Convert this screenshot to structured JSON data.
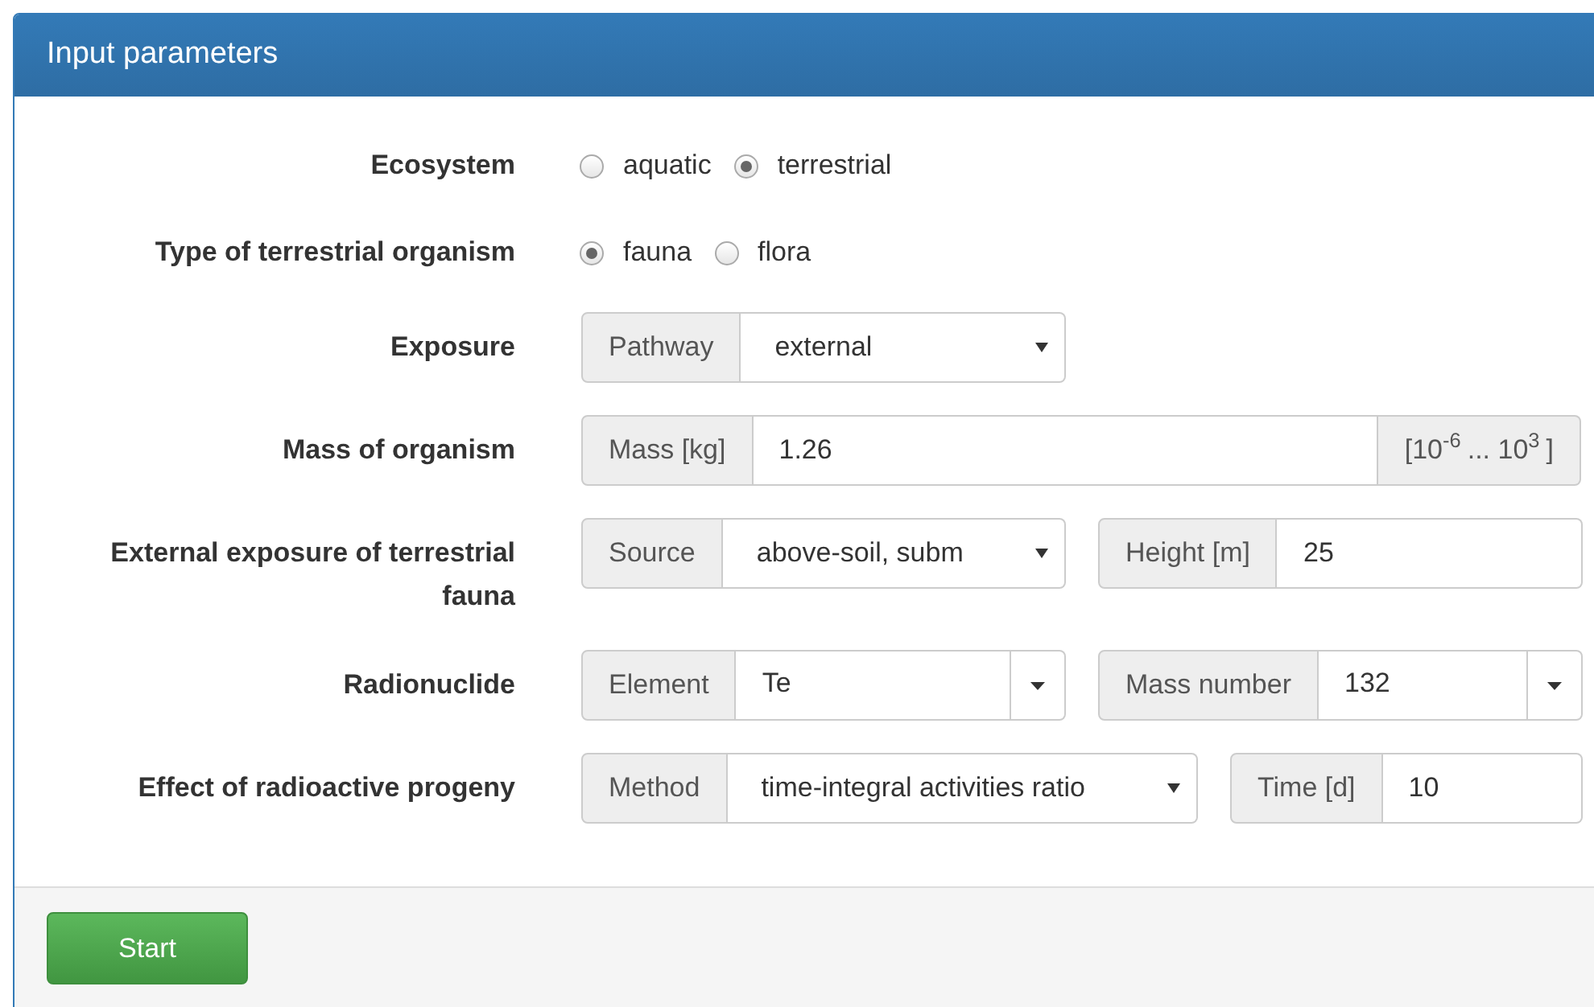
{
  "panel": {
    "title": "Input parameters"
  },
  "rows": [
    {
      "label": "Ecosystem",
      "kind": "radio",
      "options": [
        {
          "label": "aquatic",
          "selected": false
        },
        {
          "label": "terrestrial",
          "selected": true
        }
      ]
    },
    {
      "label": "Type of terrestrial organism",
      "kind": "radio",
      "options": [
        {
          "label": "fauna",
          "selected": true
        },
        {
          "label": "flora",
          "selected": false
        }
      ]
    },
    {
      "label": "Exposure",
      "kind": "groups",
      "groups": [
        {
          "addon": "Pathway",
          "kind": "select",
          "value": "external"
        }
      ]
    },
    {
      "label": "Mass of organism",
      "kind": "groups",
      "groups": [
        {
          "addon": "Mass [kg]",
          "kind": "input",
          "value": "1.26",
          "suffix": "[10$^{-6}$ ... 10$^{3}$]"
        }
      ]
    },
    {
      "label": "External exposure of terrestrial fauna",
      "kind": "groups",
      "groups": [
        {
          "addon": "Source",
          "kind": "select",
          "value": "above-soil, subm"
        },
        {
          "addon": "Height [m]",
          "kind": "input",
          "value": "25"
        }
      ]
    },
    {
      "label": "Radionuclide",
      "kind": "groups",
      "groups": [
        {
          "addon": "Element",
          "kind": "combo",
          "value": "Te"
        },
        {
          "addon": "Mass number",
          "kind": "combo",
          "value": "132"
        }
      ]
    },
    {
      "label": "Effect of radioactive progeny",
      "kind": "groups",
      "groups": [
        {
          "addon": "Method",
          "kind": "select",
          "value": "time-integral activities ratio"
        },
        {
          "addon": "Time [d]",
          "kind": "input",
          "value": "10"
        }
      ]
    }
  ],
  "footer": {
    "buttons": [
      "Start"
    ]
  }
}
